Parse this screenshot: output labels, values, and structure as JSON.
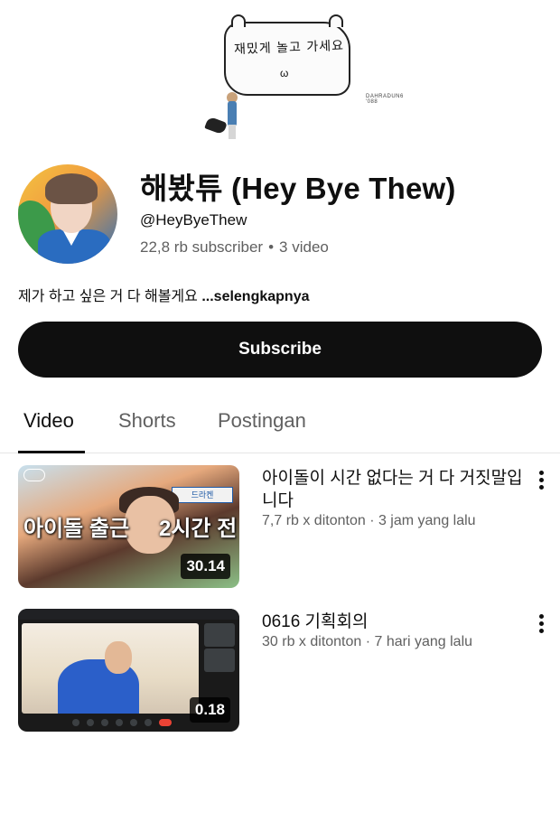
{
  "banner": {
    "text": "재밌게 놀고 가세요",
    "smile": "ω",
    "sign": "DAHRADUN6 '088"
  },
  "channel": {
    "name": "해봤튜 (Hey Bye Thew)",
    "handle": "@HeyByeThew",
    "subscribers": "22,8 rb subscriber",
    "separator": "•",
    "video_count": "3 video",
    "description": "제가 하고 싶은 거 다 해볼게요",
    "description_more": "...selengkapnya"
  },
  "subscribe_label": "Subscribe",
  "tabs": [
    {
      "label": "Video",
      "active": true
    },
    {
      "label": "Shorts",
      "active": false
    },
    {
      "label": "Postingan",
      "active": false
    }
  ],
  "videos": [
    {
      "title": "아이돌이 시간 없다는 거 다 거짓말입니다",
      "meta": "7,7 rb x ditonton · 3 jam yang lalu",
      "duration": "30.14",
      "thumb_text_left": "아이돌 출근",
      "thumb_text_right": "2시간 전",
      "thumb_sign": "드라켄"
    },
    {
      "title": "0616 기획회의",
      "meta": "30 rb x ditonton · 7 hari yang lalu",
      "duration": "0.18"
    }
  ],
  "colors": {
    "text_primary": "#0f0f0f",
    "text_secondary": "#606060",
    "button_bg": "#0f0f0f",
    "button_text": "#ffffff"
  }
}
